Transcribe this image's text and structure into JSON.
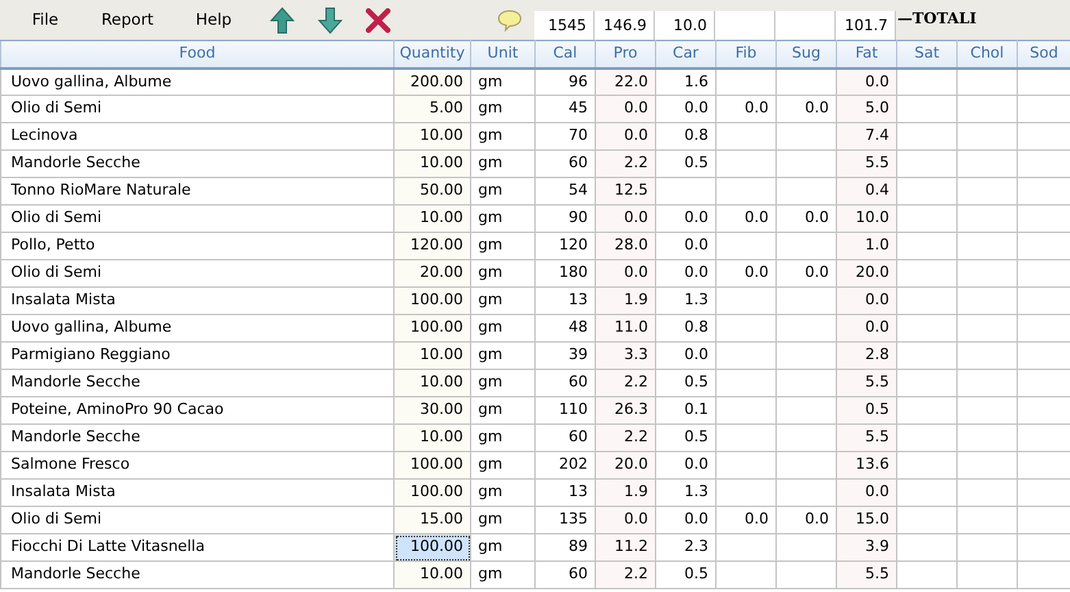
{
  "menu": [
    "File",
    "Report",
    "Help"
  ],
  "totals": {
    "cal": "1545",
    "pro": "146.9",
    "car": "10.0",
    "fat": "101.7",
    "label": "—TOTALI"
  },
  "table": {
    "columns": [
      "Food",
      "Quantity",
      "Unit",
      "Cal",
      "Pro",
      "Car",
      "Fib",
      "Sug",
      "Fat",
      "Sat",
      "Chol",
      "Sod"
    ],
    "rows": [
      {
        "food": "Uovo gallina, Albume",
        "quantity": "200.00",
        "unit": "gm",
        "cal": "96",
        "pro": "22.0",
        "car": "1.6",
        "fat": "0.0",
        "selected": false
      },
      {
        "food": "Olio di Semi",
        "quantity": "5.00",
        "unit": "gm",
        "cal": "45",
        "pro": "0.0",
        "car": "0.0",
        "fib": "0.0",
        "sug": "0.0",
        "fat": "5.0",
        "selected": false
      },
      {
        "food": "Lecinova",
        "quantity": "10.00",
        "unit": "gm",
        "cal": "70",
        "pro": "0.0",
        "car": "0.8",
        "fat": "7.4",
        "selected": false
      },
      {
        "food": "Mandorle Secche",
        "quantity": "10.00",
        "unit": "gm",
        "cal": "60",
        "pro": "2.2",
        "car": "0.5",
        "fat": "5.5",
        "selected": false
      },
      {
        "food": "Tonno RioMare Naturale",
        "quantity": "50.00",
        "unit": "gm",
        "cal": "54",
        "pro": "12.5",
        "fat": "0.4",
        "selected": false
      },
      {
        "food": "Olio di Semi",
        "quantity": "10.00",
        "unit": "gm",
        "cal": "90",
        "pro": "0.0",
        "car": "0.0",
        "fib": "0.0",
        "sug": "0.0",
        "fat": "10.0",
        "selected": false
      },
      {
        "food": "Pollo, Petto",
        "quantity": "120.00",
        "unit": "gm",
        "cal": "120",
        "pro": "28.0",
        "car": "0.0",
        "fat": "1.0",
        "selected": false
      },
      {
        "food": "Olio di Semi",
        "quantity": "20.00",
        "unit": "gm",
        "cal": "180",
        "pro": "0.0",
        "car": "0.0",
        "fib": "0.0",
        "sug": "0.0",
        "fat": "20.0",
        "selected": false
      },
      {
        "food": "Insalata Mista",
        "quantity": "100.00",
        "unit": "gm",
        "cal": "13",
        "pro": "1.9",
        "car": "1.3",
        "fat": "0.0",
        "selected": false
      },
      {
        "food": "Uovo gallina, Albume",
        "quantity": "100.00",
        "unit": "gm",
        "cal": "48",
        "pro": "11.0",
        "car": "0.8",
        "fat": "0.0",
        "selected": false
      },
      {
        "food": "Parmigiano Reggiano",
        "quantity": "10.00",
        "unit": "gm",
        "cal": "39",
        "pro": "3.3",
        "car": "0.0",
        "fat": "2.8",
        "selected": false
      },
      {
        "food": "Mandorle Secche",
        "quantity": "10.00",
        "unit": "gm",
        "cal": "60",
        "pro": "2.2",
        "car": "0.5",
        "fat": "5.5",
        "selected": false
      },
      {
        "food": "Poteine, AminoPro 90 Cacao",
        "quantity": "30.00",
        "unit": "gm",
        "cal": "110",
        "pro": "26.3",
        "car": "0.1",
        "fat": "0.5",
        "selected": false
      },
      {
        "food": "Mandorle Secche",
        "quantity": "10.00",
        "unit": "gm",
        "cal": "60",
        "pro": "2.2",
        "car": "0.5",
        "fat": "5.5",
        "selected": false
      },
      {
        "food": "Salmone Fresco",
        "quantity": "100.00",
        "unit": "gm",
        "cal": "202",
        "pro": "20.0",
        "car": "0.0",
        "fat": "13.6",
        "selected": false
      },
      {
        "food": "Insalata Mista",
        "quantity": "100.00",
        "unit": "gm",
        "cal": "13",
        "pro": "1.9",
        "car": "1.3",
        "fat": "0.0",
        "selected": false
      },
      {
        "food": "Olio di Semi",
        "quantity": "15.00",
        "unit": "gm",
        "cal": "135",
        "pro": "0.0",
        "car": "0.0",
        "fib": "0.0",
        "sug": "0.0",
        "fat": "15.0",
        "selected": false
      },
      {
        "food": "Fiocchi Di Latte Vitasnella",
        "quantity": "100.00",
        "unit": "gm",
        "cal": "89",
        "pro": "11.2",
        "car": "2.3",
        "fat": "3.9",
        "selected": true
      },
      {
        "food": "Mandorle Secche",
        "quantity": "10.00",
        "unit": "gm",
        "cal": "60",
        "pro": "2.2",
        "car": "0.5",
        "fat": "5.5",
        "selected": false
      }
    ]
  }
}
